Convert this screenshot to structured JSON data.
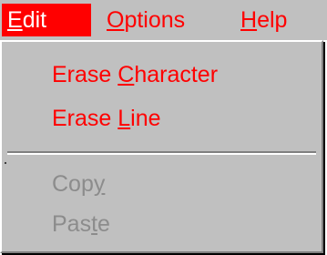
{
  "colors": {
    "menu_text": "#ff0000",
    "menu_bg": "#c0c0c0",
    "active_bg": "#ff0000",
    "active_text": "#ffffff",
    "disabled_text": "#8c8c8c"
  },
  "menubar": {
    "edit": {
      "mnemonic": "E",
      "rest": "dit"
    },
    "options": {
      "mnemonic": "O",
      "rest": "ptions"
    },
    "help": {
      "mnemonic": "H",
      "rest": "elp"
    }
  },
  "edit_menu": {
    "erase_character": {
      "pre": "Erase ",
      "mnemonic": "C",
      "post": "haracter"
    },
    "erase_line": {
      "pre": "Erase ",
      "mnemonic": "L",
      "post": "ine"
    },
    "copy": {
      "pre": "Cop",
      "mnemonic": "y",
      "post": "",
      "disabled": true
    },
    "paste": {
      "pre": "Pas",
      "mnemonic": "t",
      "post": "e",
      "disabled": true
    }
  }
}
